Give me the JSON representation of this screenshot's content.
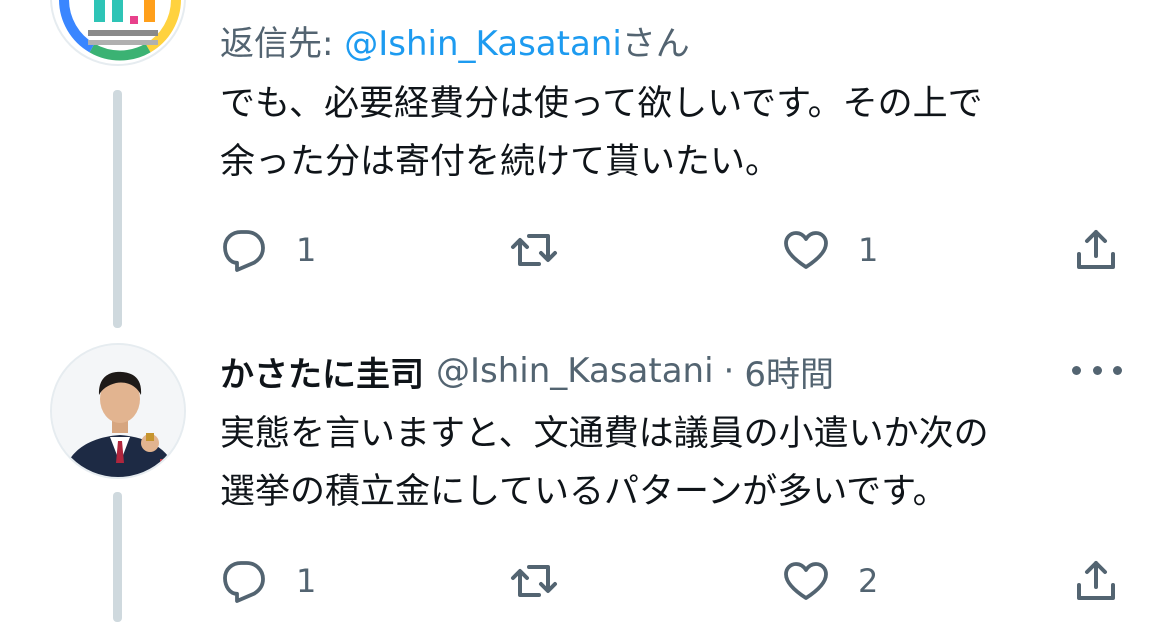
{
  "first_tweet": {
    "reply_prefix": "返信先: ",
    "reply_mention": "@Ishin_Kasatani",
    "reply_suffix": "さん",
    "text_lines": [
      "でも、必要経費分は使って欲しいです。その上で",
      "余った分は寄付を続けて貰いたい。"
    ],
    "actions": {
      "reply_count": "1",
      "retweet_count": "",
      "like_count": "1"
    }
  },
  "second_tweet": {
    "display_name": "かさたに圭司",
    "handle": "@Ishin_Kasatani",
    "separator": "·",
    "time": "6時間",
    "text_lines": [
      "実態を言いますと、文通費は議員の小遣いか次の",
      "選挙の積立金にしているパターンが多いです。"
    ],
    "actions": {
      "reply_count": "1",
      "retweet_count": "",
      "like_count": "2"
    }
  },
  "icons": {
    "reply": "reply-icon",
    "retweet": "retweet-icon",
    "like": "heart-icon",
    "share": "share-icon",
    "more": "more-icon"
  },
  "colors": {
    "text": "#0f1419",
    "secondary": "#536471",
    "link": "#1d9bf0",
    "thread_line": "#cfd9de"
  }
}
